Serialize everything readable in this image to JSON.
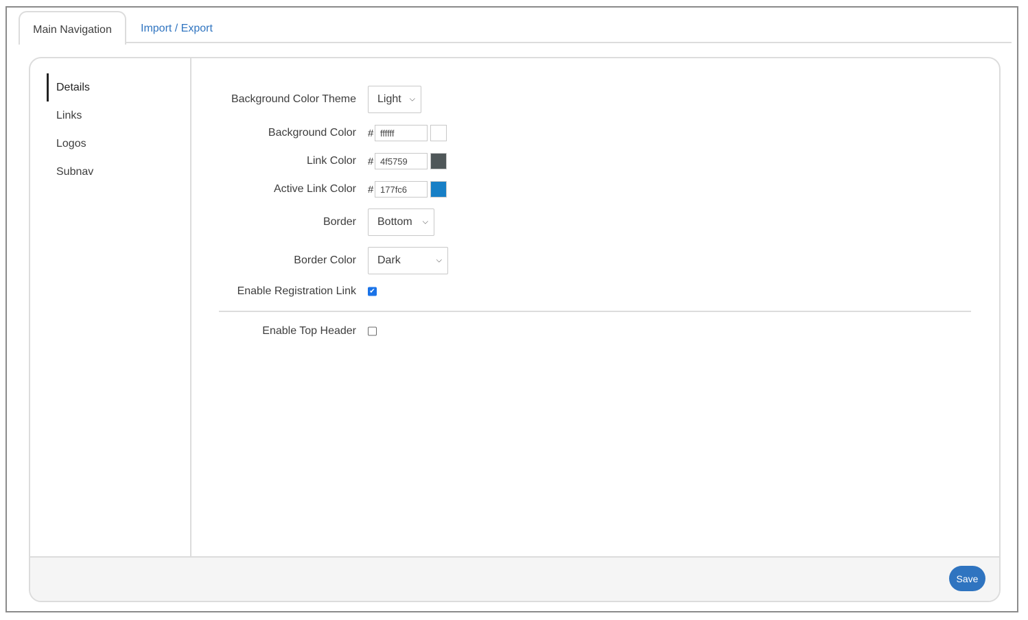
{
  "tabs": [
    {
      "label": "Main Navigation",
      "active": true
    },
    {
      "label": "Import / Export",
      "active": false
    }
  ],
  "sidebar": {
    "items": [
      {
        "label": "Details",
        "active": true
      },
      {
        "label": "Links",
        "active": false
      },
      {
        "label": "Logos",
        "active": false
      },
      {
        "label": "Subnav",
        "active": false
      }
    ]
  },
  "form": {
    "background_color_theme": {
      "label": "Background Color Theme",
      "value": "Light"
    },
    "background_color": {
      "label": "Background Color",
      "prefix": "#",
      "value": "ffffff",
      "swatch": "#ffffff"
    },
    "link_color": {
      "label": "Link Color",
      "prefix": "#",
      "value": "4f5759",
      "swatch": "#4f5759"
    },
    "active_link_color": {
      "label": "Active Link Color",
      "prefix": "#",
      "value": "177fc6",
      "swatch": "#177fc6"
    },
    "border": {
      "label": "Border",
      "value": "Bottom"
    },
    "border_color": {
      "label": "Border Color",
      "value": "Dark"
    },
    "enable_registration_link": {
      "label": "Enable Registration Link",
      "checked": true
    },
    "enable_top_header": {
      "label": "Enable Top Header",
      "checked": false
    }
  },
  "footer": {
    "save_label": "Save"
  },
  "colors": {
    "accent": "#2f74c0",
    "checkbox": "#1a73e8",
    "border": "#dcdcdc"
  }
}
